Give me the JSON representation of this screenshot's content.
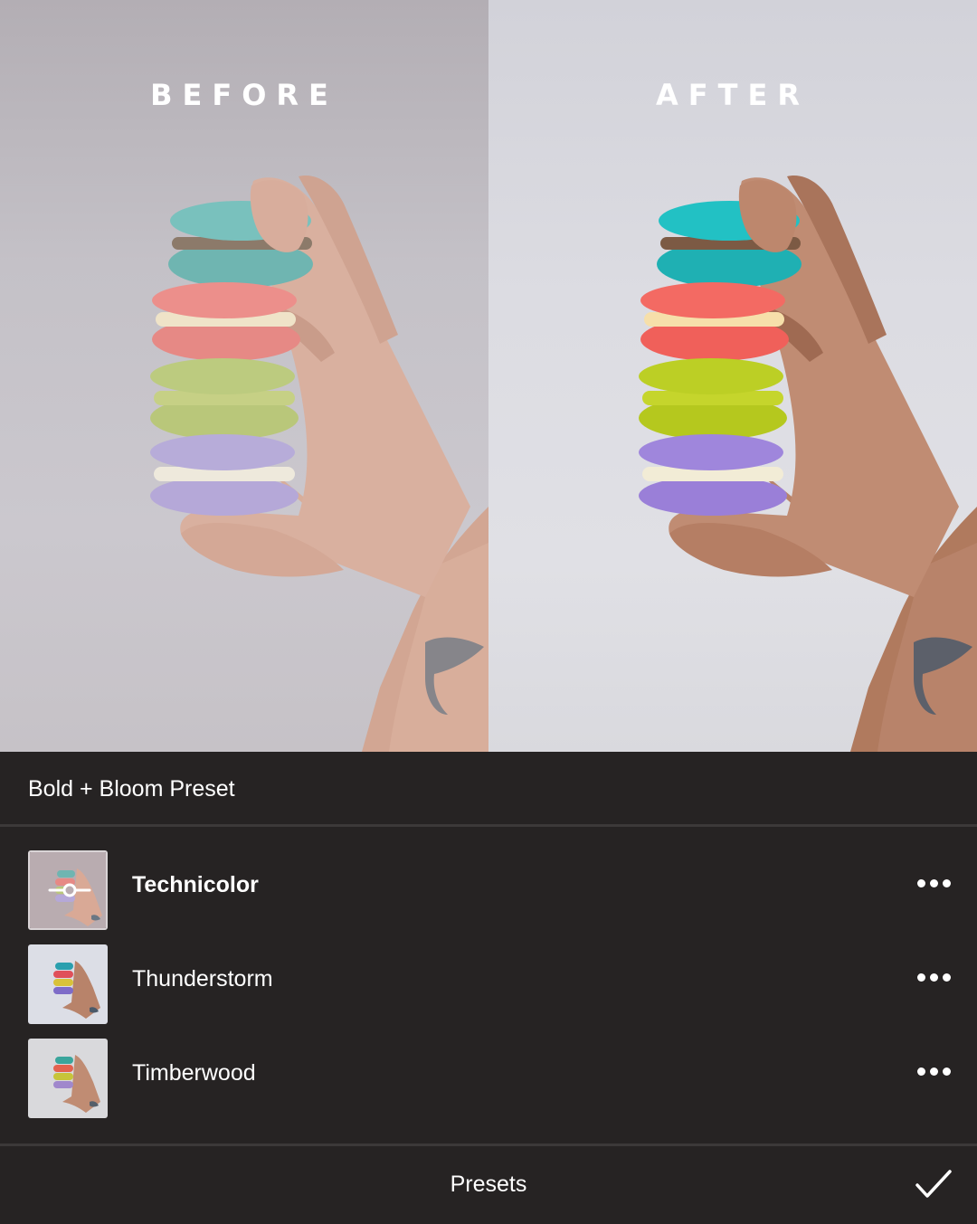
{
  "comparison": {
    "before_label": "BEFORE",
    "after_label": "AFTER"
  },
  "panel": {
    "group_title": "Bold + Bloom Preset",
    "presets": [
      {
        "name": "Technicolor",
        "selected": true
      },
      {
        "name": "Thunderstorm",
        "selected": false
      },
      {
        "name": "Timberwood",
        "selected": false
      }
    ],
    "more_icon": "more-dots-icon",
    "adjust_icon": "slider-adjust-icon"
  },
  "footer": {
    "label": "Presets",
    "confirm_icon": "checkmark-icon"
  },
  "colors": {
    "panel_bg": "#262323",
    "divider": "#3c3939",
    "text": "#ffffff"
  }
}
